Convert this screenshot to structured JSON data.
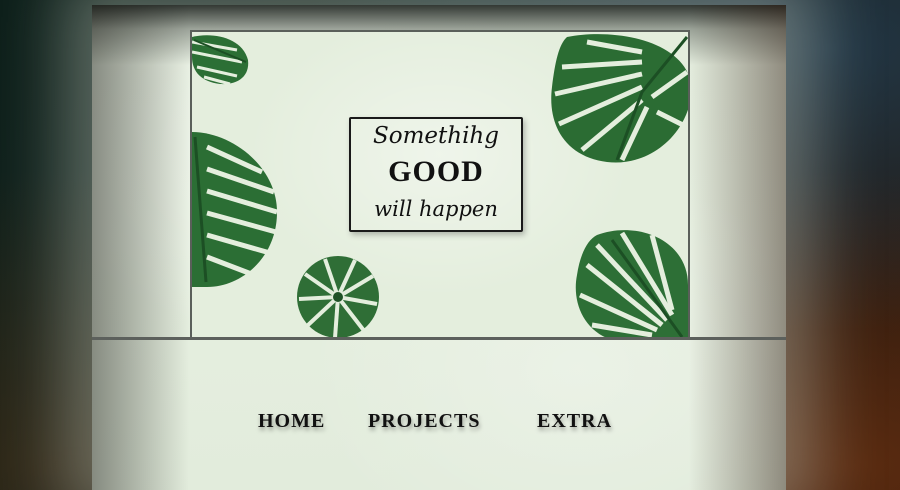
{
  "hero": {
    "quote": {
      "line1": "Somethihg",
      "line2": "GOOD",
      "line3": "will happen"
    }
  },
  "nav": {
    "items": [
      {
        "label": "HOME"
      },
      {
        "label": "PROJECTS"
      },
      {
        "label": "EXTRA"
      }
    ]
  },
  "colors": {
    "leaf_dark": "#1f5a2a",
    "leaf_mid": "#2e7a38",
    "paper": "#e4eedd",
    "frame": "#5a5f5a"
  }
}
